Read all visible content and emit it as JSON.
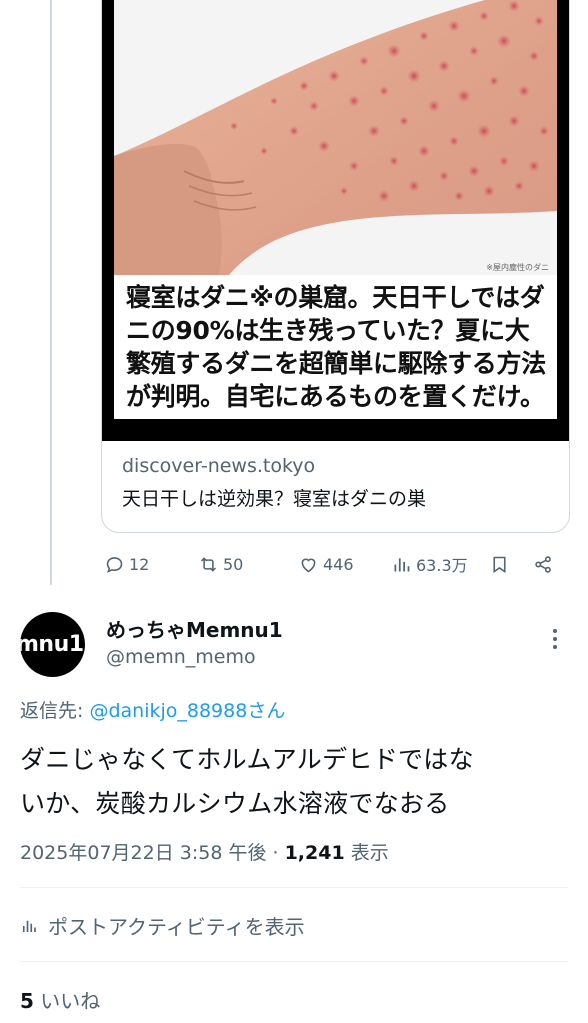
{
  "card": {
    "caption": "寝室はダニ※の巣窟。天日干しではダニの90%は生き残っていた？夏に大繁殖するダニを超簡単に駆除する方法が判明。自宅にあるものを置くだけ。",
    "photo_note": "※屋内塵性のダニ",
    "domain": "discover-news.tokyo",
    "title": "天日干しは逆効果？寝室はダニの巣"
  },
  "parent_actions": {
    "replies": "12",
    "reposts": "50",
    "likes": "446",
    "views": "63.3万"
  },
  "reply": {
    "avatar_text": "mnu1",
    "display_name": "めっちゃMemnu1",
    "handle": "@memn_memo",
    "reply_to_prefix": "返信先: ",
    "reply_to_mention": "@danikjo_88988さん",
    "text_line1": "ダニじゃなくてホルムアルデヒドではな",
    "text_line2": "いか、炭酸カルシウム水溶液でなおる",
    "timestamp": "2025年07月22日 3:58 午後 · ",
    "view_count": "1,241",
    "view_label": " 表示",
    "activity_label": "ポストアクティビティを表示",
    "like_count": "5",
    "like_label": " いいね"
  },
  "colors": {
    "text": "#0f1419",
    "secondary": "#536471",
    "link": "#1d9bf0",
    "border": "#cfd9de"
  }
}
